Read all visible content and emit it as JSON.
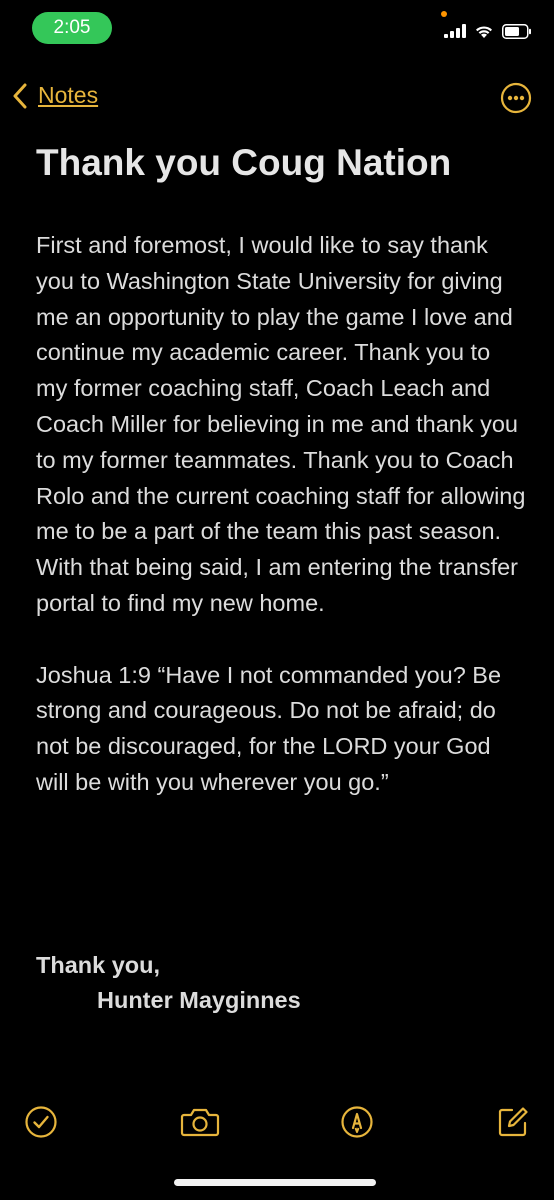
{
  "status_bar": {
    "time": "2:05"
  },
  "nav": {
    "back_label": "Notes"
  },
  "note": {
    "title": "Thank you Coug Nation",
    "paragraphs": [
      "First and foremost, I would like to say thank you to Washington State University for giving me an opportunity to play the game I love and continue my academic career. Thank you to my former coaching staff, Coach Leach and Coach Miller for believing in me and thank you to my former teammates. Thank you to Coach Rolo and the current coaching staff for allowing me to be a part of the team this past season. With that being said, I am entering the transfer portal to find my new home.",
      "Joshua 1:9 “Have I not commanded you? Be strong and courageous. Do not be afraid; do not be discouraged, for the LORD your God will be with you wherever you go.”"
    ],
    "signoff": "Thank you,",
    "signature": "Hunter Mayginnes"
  },
  "colors": {
    "accent": "#e7b53c",
    "background": "#000000",
    "time_pill": "#34c759"
  },
  "icons": {
    "toolbar": [
      "checklist-icon",
      "camera-icon",
      "markup-icon",
      "compose-icon"
    ]
  }
}
